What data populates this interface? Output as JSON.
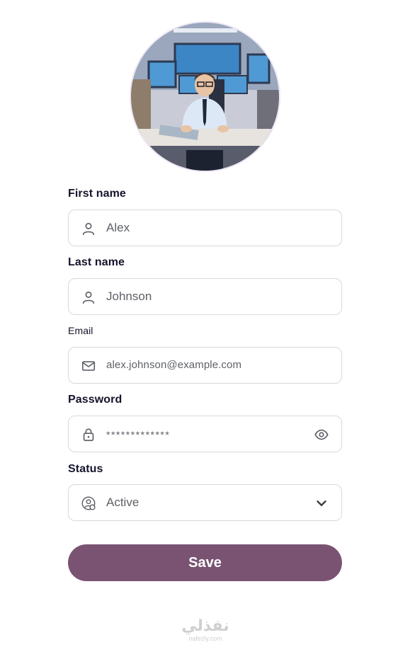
{
  "profile": {
    "avatar_alt": "Profile photo"
  },
  "form": {
    "first_name": {
      "label": "First name",
      "value": "Alex",
      "icon": "person-icon"
    },
    "last_name": {
      "label": "Last name",
      "value": "Johnson",
      "icon": "person-icon"
    },
    "email": {
      "label": "Email",
      "value": "alex.johnson@example.com",
      "icon": "mail-icon"
    },
    "password": {
      "label": "Password",
      "value": "*************",
      "icon": "lock-icon",
      "toggle_icon": "eye-icon"
    },
    "status": {
      "label": "Status",
      "value": "Active",
      "icon": "user-status-icon",
      "dropdown_icon": "chevron-down-icon"
    }
  },
  "save_label": "Save",
  "watermark": {
    "brand": "نفذلي",
    "domain": "nafezly.com"
  },
  "colors": {
    "accent": "#7a5373",
    "label_text": "#14142b",
    "field_text": "#5f6168",
    "field_border": "#d9d9de"
  }
}
